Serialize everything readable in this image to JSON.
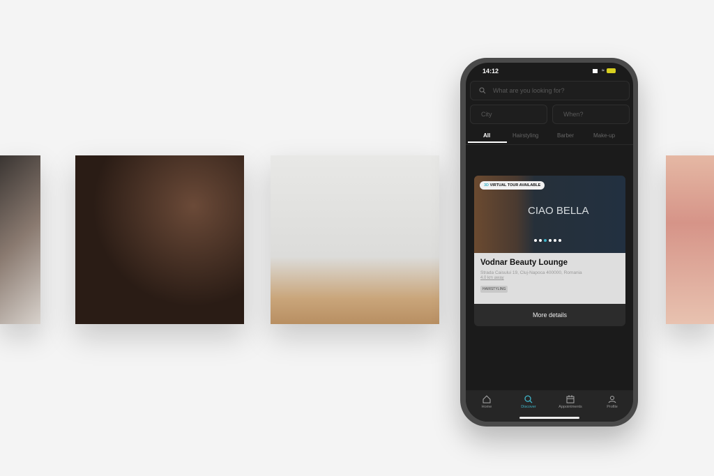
{
  "status": {
    "time": "14:12"
  },
  "search": {
    "placeholder": "What are you looking for?",
    "city_placeholder": "City",
    "when_placeholder": "When?"
  },
  "tabs": [
    {
      "label": "All",
      "active": true
    },
    {
      "label": "Hairstyling"
    },
    {
      "label": "Barber"
    },
    {
      "label": "Make-up"
    }
  ],
  "card": {
    "badge_prefix": "3D",
    "badge": "VIRTUAL TOUR AVAILABLE",
    "sign": "CIAO BELLA",
    "title": "Vodnar Beauty Lounge",
    "address": "Strada Caisului 19, Cluj-Napoca 400000, Romania",
    "distance": "4.0 km away",
    "tag": "HAIRSTYLING",
    "button": "More details",
    "carousel_dots": 6,
    "carousel_active": 3
  },
  "nav": [
    {
      "label": "Home",
      "icon": "home-icon"
    },
    {
      "label": "Discover",
      "icon": "search-icon",
      "active": true
    },
    {
      "label": "Appointments",
      "icon": "calendar-icon"
    },
    {
      "label": "Profile",
      "icon": "user-icon"
    }
  ],
  "colors": {
    "accent": "#3fb4c8",
    "screen_bg": "#1b1b1b"
  }
}
